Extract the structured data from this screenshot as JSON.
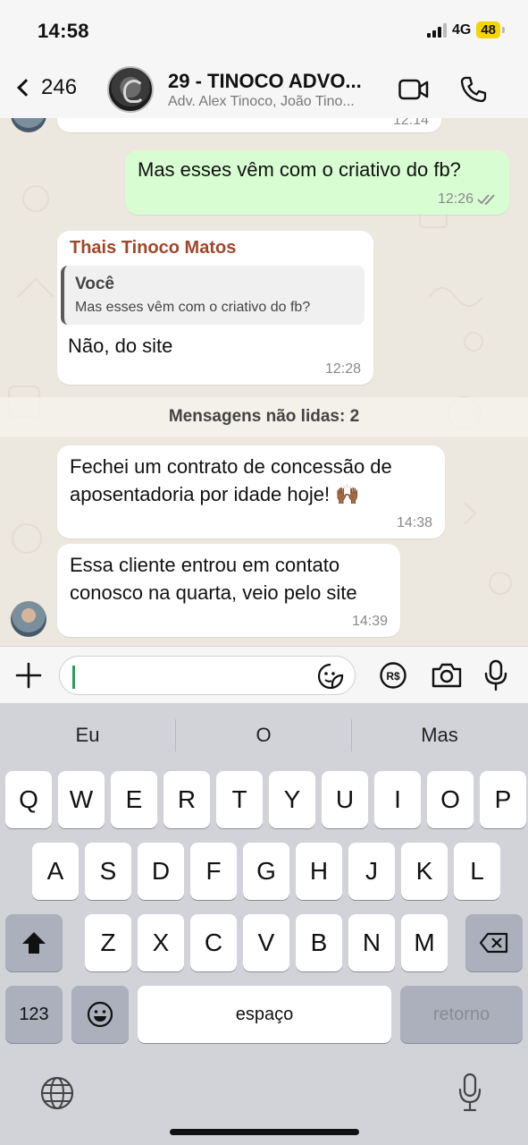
{
  "status": {
    "time": "14:58",
    "network": "4G",
    "battery": "48"
  },
  "header": {
    "back_count": "246",
    "title": "29 - TINOCO ADVO...",
    "subtitle": "Adv. Alex Tinoco, João Tino..."
  },
  "messages": [
    {
      "direction": "in",
      "sender": "",
      "text": "",
      "time": "12:14",
      "partial": true
    },
    {
      "direction": "out",
      "text": "Mas esses vêm com o criativo do fb?",
      "time": "12:26",
      "status": "read"
    },
    {
      "direction": "in",
      "sender": "Thais Tinoco Matos",
      "quote_author": "Você",
      "quote_text": "Mas esses vêm com o criativo do fb?",
      "text": "Não, do site",
      "time": "12:28"
    },
    {
      "direction": "in",
      "text": "Fechei um contrato de concessão de aposentadoria por idade hoje! 🙌🏾",
      "line1": "Fechei um contrato de concessão de",
      "line2": "aposentadoria por idade hoje! 🙌🏾",
      "time": "14:38"
    },
    {
      "direction": "in",
      "text": "Essa cliente entrou em contato conosco na quarta, veio pelo site",
      "line1": "Essa cliente entrou em contato",
      "line2": "conosco na quarta, veio pelo site",
      "time": "14:39"
    }
  ],
  "unread_divider": "Mensagens não lidas: 2",
  "input": {
    "value": "",
    "placeholder": ""
  },
  "keyboard": {
    "suggestions": [
      "Eu",
      "O",
      "Mas"
    ],
    "row1": [
      "Q",
      "W",
      "E",
      "R",
      "T",
      "Y",
      "U",
      "I",
      "O",
      "P"
    ],
    "row2": [
      "A",
      "S",
      "D",
      "F",
      "G",
      "H",
      "J",
      "K",
      "L"
    ],
    "row3": [
      "Z",
      "X",
      "C",
      "V",
      "B",
      "N",
      "M"
    ],
    "numbers_label": "123",
    "space_label": "espaço",
    "return_label": "retorno"
  },
  "colors": {
    "outgoing_bubble": "#d9fdd3",
    "sender_name": "#a0472b",
    "battery": "#f5d400"
  }
}
